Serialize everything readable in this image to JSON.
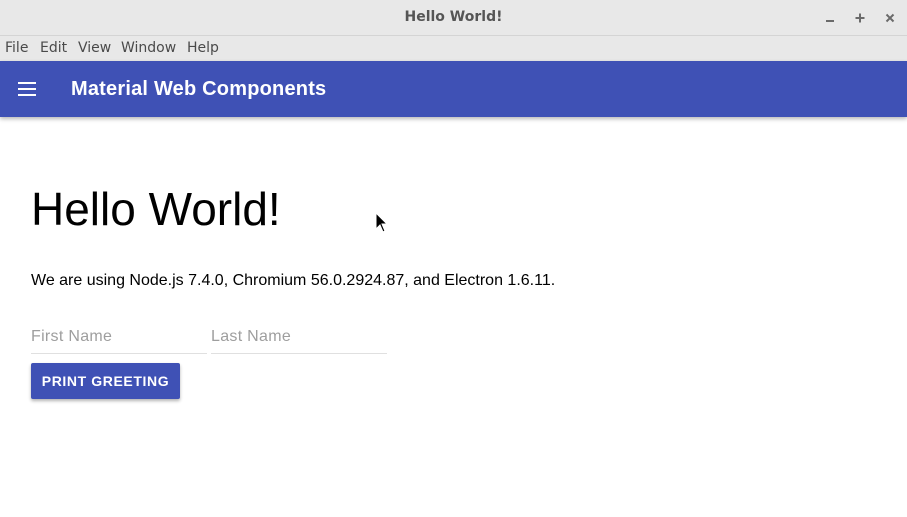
{
  "window": {
    "title": "Hello World!",
    "controls": {
      "minimize_icon": "minimize-icon",
      "maximize_icon": "maximize-icon",
      "close_icon": "close-icon"
    }
  },
  "menubar": {
    "items": [
      {
        "label": "File"
      },
      {
        "label": "Edit"
      },
      {
        "label": "View"
      },
      {
        "label": "Window"
      },
      {
        "label": "Help"
      }
    ]
  },
  "appbar": {
    "title": "Material Web Components",
    "menu_icon": "hamburger-menu-icon",
    "color": "#3f51b5"
  },
  "main": {
    "heading": "Hello World!",
    "info": "We are using Node.js 7.4.0, Chromium 56.0.2924.87, and Electron 1.6.11.",
    "first_name": {
      "placeholder": "First Name",
      "value": ""
    },
    "last_name": {
      "placeholder": "Last Name",
      "value": ""
    },
    "button_label": "PRINT GREETING"
  },
  "colors": {
    "primary": "#3f51b5",
    "chrome": "#e8e8e8",
    "text": "#000000"
  }
}
